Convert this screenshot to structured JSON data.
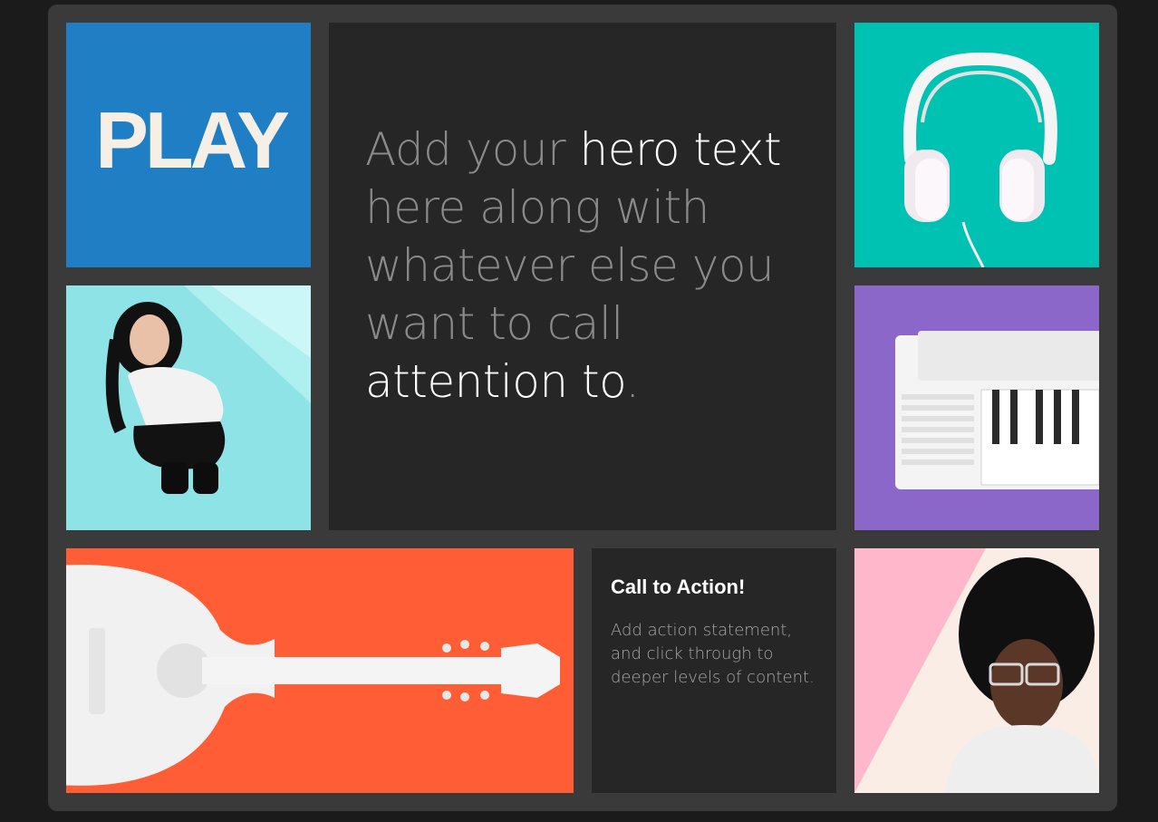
{
  "logo": {
    "text": "PLAY",
    "icon": "play-logo"
  },
  "hero": {
    "line1_dim": "Add your ",
    "line1_hl": "hero text",
    "line2": "here along with",
    "line3": "whatever else you",
    "line4": "want to call",
    "line5_hl": "attention to",
    "line5_dim": "."
  },
  "cta": {
    "title": "Call to Action!",
    "body": "Add action statement, and click through to deeper levels of content."
  },
  "colors": {
    "page_bg": "#1b1b1b",
    "frame_bg": "#3a3a3a",
    "logo_blue": "#1f7ec4",
    "teal": "#00c2b3",
    "light_cyan": "#8ee3e6",
    "purple": "#8a67c9",
    "orange": "#ff5d35",
    "pink": "#fbe4e4",
    "dark_tile": "#262626"
  },
  "images": [
    {
      "icon": "headphones-image"
    },
    {
      "icon": "woman-portrait-image"
    },
    {
      "icon": "keyboard-image"
    },
    {
      "icon": "guitar-image"
    },
    {
      "icon": "man-portrait-image"
    }
  ]
}
